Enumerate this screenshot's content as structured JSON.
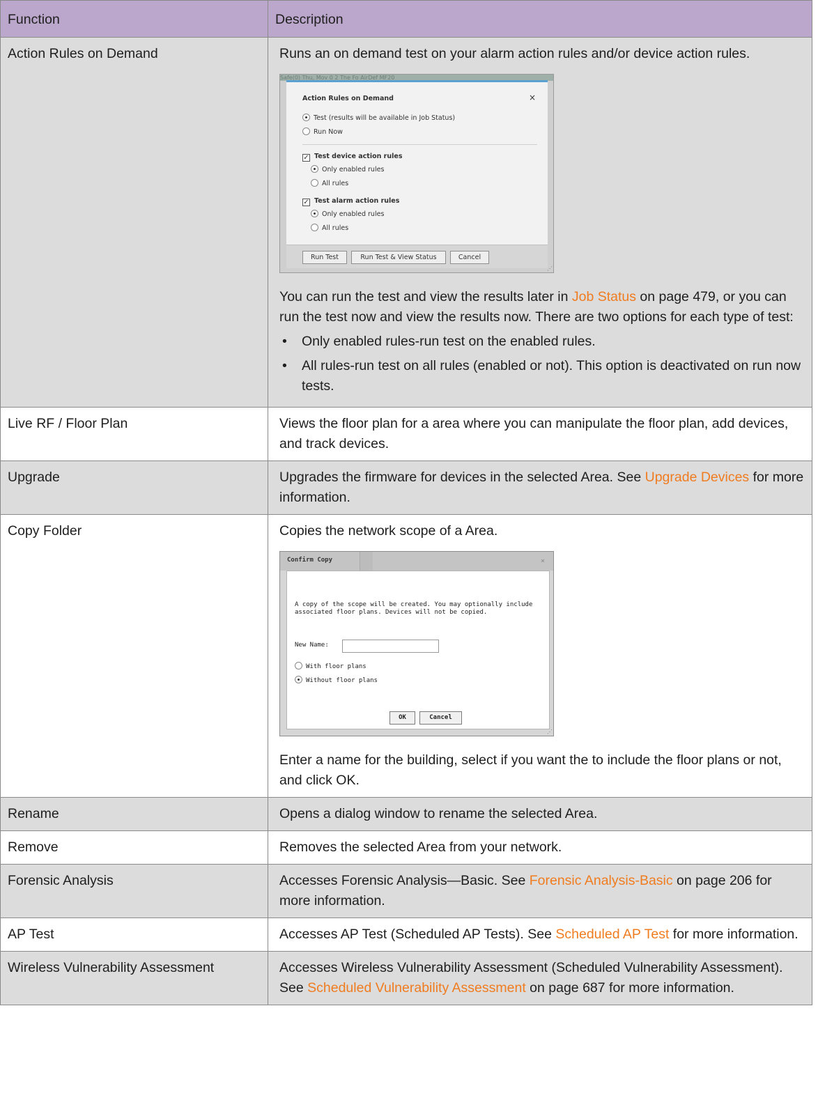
{
  "header": {
    "col1": "Function",
    "col2": "Description"
  },
  "rows": {
    "action_rules": {
      "function": "Action Rules on Demand",
      "desc_intro": "Runs an on demand test on your alarm action rules and/or device action rules.",
      "dialog": {
        "bg_text": "Safe(0)      Thu, Mov 0 2      The Fo      AirDef      MF20",
        "title": "Action Rules on Demand",
        "close": "×",
        "radio_test": "Test (results will be available in Job Status)",
        "radio_run_now": "Run Now",
        "device_heading": "Test device action rules",
        "device_only_enabled": "Only enabled rules",
        "device_all": "All rules",
        "alarm_heading": "Test alarm action rules",
        "alarm_only_enabled": "Only enabled rules",
        "alarm_all": "All rules",
        "btn_run_test": "Run Test",
        "btn_run_view": "Run Test & View Status",
        "btn_cancel": "Cancel"
      },
      "desc_after_pre": "You can run the test and view the results later in ",
      "link_job_status": "Job Status",
      "desc_after_post": " on page 479, or you can run the test now and view the results now. There are two options for each type of test:",
      "bullets": [
        "Only enabled rules-run test on the enabled rules.",
        "All rules-run test on all rules (enabled or not). This option is deactivated on run now tests."
      ]
    },
    "live_rf": {
      "function": "Live RF / Floor Plan",
      "desc": "Views the floor plan for a area where you can manipulate the floor plan, add devices, and track devices."
    },
    "upgrade": {
      "function": "Upgrade",
      "desc_pre": "Upgrades the firmware for devices in the selected Area. See ",
      "link": "Upgrade Devices",
      "desc_post": " for more information."
    },
    "copy_folder": {
      "function": "Copy Folder",
      "desc": "Copies the network scope of a Area.",
      "dialog": {
        "title": "Confirm Copy",
        "close": "×",
        "message_line1": "A copy of the scope will be created. You may optionally include",
        "message_line2": "associated floor plans. Devices will not be copied.",
        "name_label": "New Name:",
        "radio_with": "With floor plans",
        "radio_without": "Without floor plans",
        "btn_ok": "OK",
        "btn_cancel": "Cancel"
      },
      "desc_after": "Enter a name for the building, select if you want the to include the floor plans or not, and click OK."
    },
    "rename": {
      "function": "Rename",
      "desc": "Opens a dialog window to rename the selected Area."
    },
    "remove": {
      "function": "Remove",
      "desc": "Removes the selected Area from your network."
    },
    "forensic": {
      "function": "Forensic Analysis",
      "desc_pre": "Accesses Forensic Analysis—Basic. See ",
      "link": "Forensic Analysis-Basic",
      "desc_post": " on page 206 for more information."
    },
    "ap_test": {
      "function": "AP Test",
      "desc_pre": "Accesses AP Test (Scheduled AP Tests). See ",
      "link": "Scheduled AP Test",
      "desc_post": " for more information."
    },
    "wva": {
      "function": "Wireless Vulnerability Assessment",
      "desc_pre": "Accesses Wireless Vulnerability Assessment (Scheduled Vulnerability Assessment). See ",
      "link": "Scheduled Vulnerability Assessment",
      "desc_post": " on page 687 for more information."
    }
  },
  "colors": {
    "header_bg": "#bba7cb",
    "shaded_row": "#dcdcdc",
    "link": "#f07c20"
  },
  "icons": {
    "bullet": "•"
  }
}
